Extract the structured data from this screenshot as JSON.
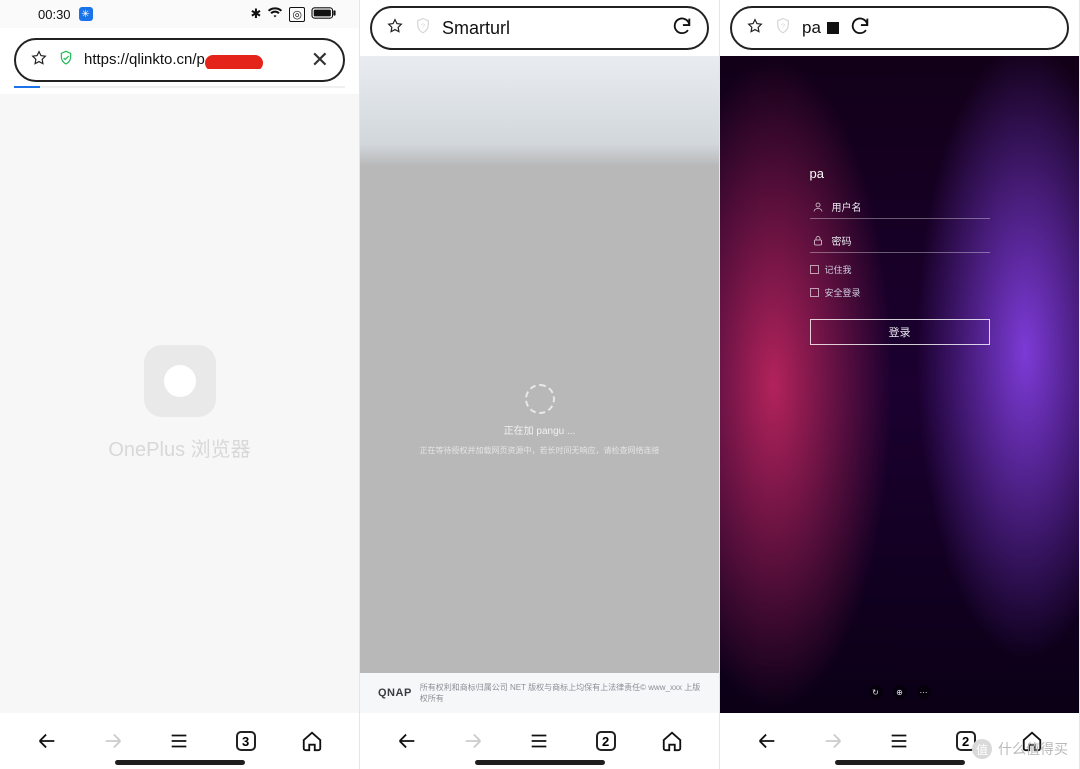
{
  "watermark": "什么值得买",
  "phone1": {
    "status_time": "00:30",
    "url_prefix": "https://qlinkto.cn/p",
    "splash_text": "OnePlus 浏览器",
    "nav_tab_count": "3"
  },
  "phone2": {
    "url_title": "Smarturl",
    "loading_line1": "正在加 pangu ...",
    "loading_line2": "正在等待授权并加载网页资源中，若长时间无响应，请检查网络连接",
    "footer_brand": "QNAP",
    "footer_text": "所有权利和商标归属公司 NET 版权与商标上均保有上法律责任© www_xxx 上版权所有",
    "nav_tab_count": "2"
  },
  "phone3": {
    "url_title": "pa",
    "login_title": "pa",
    "username_label": "用户名",
    "password_label": "密码",
    "remember_label": "记住我",
    "secure_label": "安全登录",
    "login_button": "登录",
    "nav_tab_count": "2"
  }
}
